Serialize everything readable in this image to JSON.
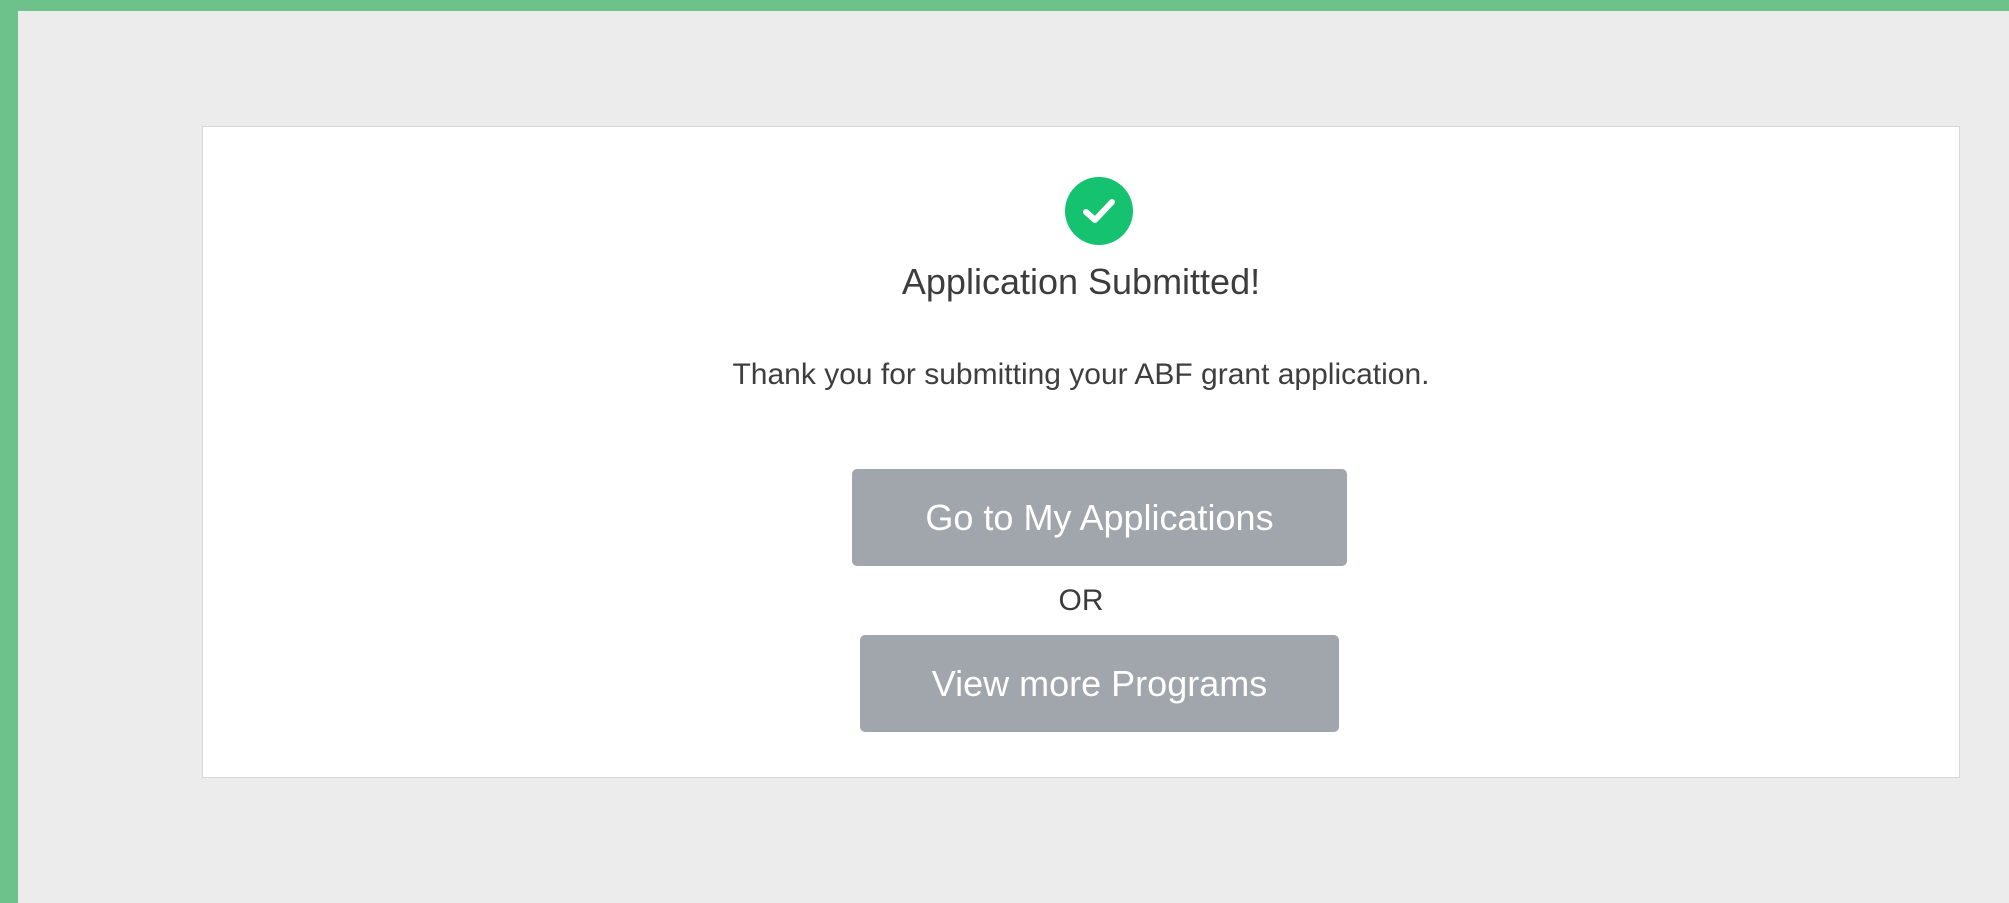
{
  "confirmation": {
    "icon": "check-circle-icon",
    "title": "Application Submitted!",
    "message": "Thank you for submitting your ABF grant application.",
    "or_text": "OR"
  },
  "actions": {
    "my_applications_label": "Go to My Applications",
    "view_programs_label": "View more Programs"
  },
  "colors": {
    "frame": "#6cc28a",
    "background": "#ececec",
    "card": "#ffffff",
    "success": "#14c26f",
    "button": "#a0a6ac",
    "button_text": "#ffffff",
    "text": "#3e3e3e"
  }
}
